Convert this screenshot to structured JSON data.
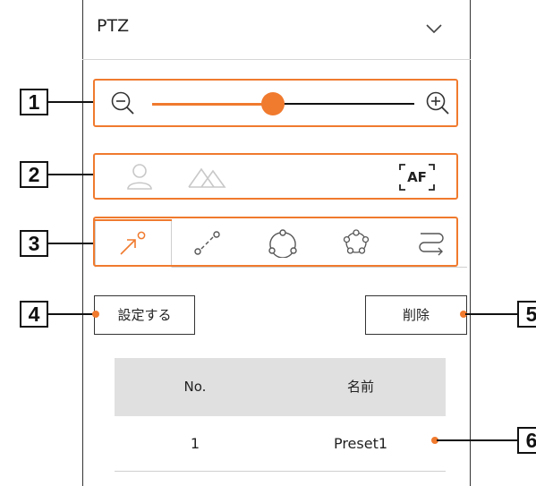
{
  "header": {
    "title": "PTZ",
    "chevron_icon": "chevron-down-icon"
  },
  "callouts": [
    "1",
    "2",
    "3",
    "4",
    "5",
    "6"
  ],
  "zoom": {
    "level_fraction": 0.46,
    "zoom_out_icon": "zoom-out-icon",
    "zoom_in_icon": "zoom-in-icon"
  },
  "focus_controls": {
    "icons": [
      "person-icon",
      "mountain-icon"
    ],
    "autofocus_label": "AF"
  },
  "tabs": [
    {
      "icon": "arrow-icon",
      "active": true
    },
    {
      "icon": "path-dots-icon",
      "active": false
    },
    {
      "icon": "triangle-cycle-icon",
      "active": false
    },
    {
      "icon": "pentagon-cycle-icon",
      "active": false
    },
    {
      "icon": "route-icon",
      "active": false
    }
  ],
  "buttons": {
    "set": "設定する",
    "delete": "削除"
  },
  "table": {
    "headers": [
      "No.",
      "名前"
    ],
    "rows": [
      {
        "no": "1",
        "name": "Preset1"
      }
    ]
  },
  "colors": {
    "accent": "#f07a2e",
    "disabled_icon": "#c8c8c8",
    "table_header": "#e0e0e0"
  }
}
